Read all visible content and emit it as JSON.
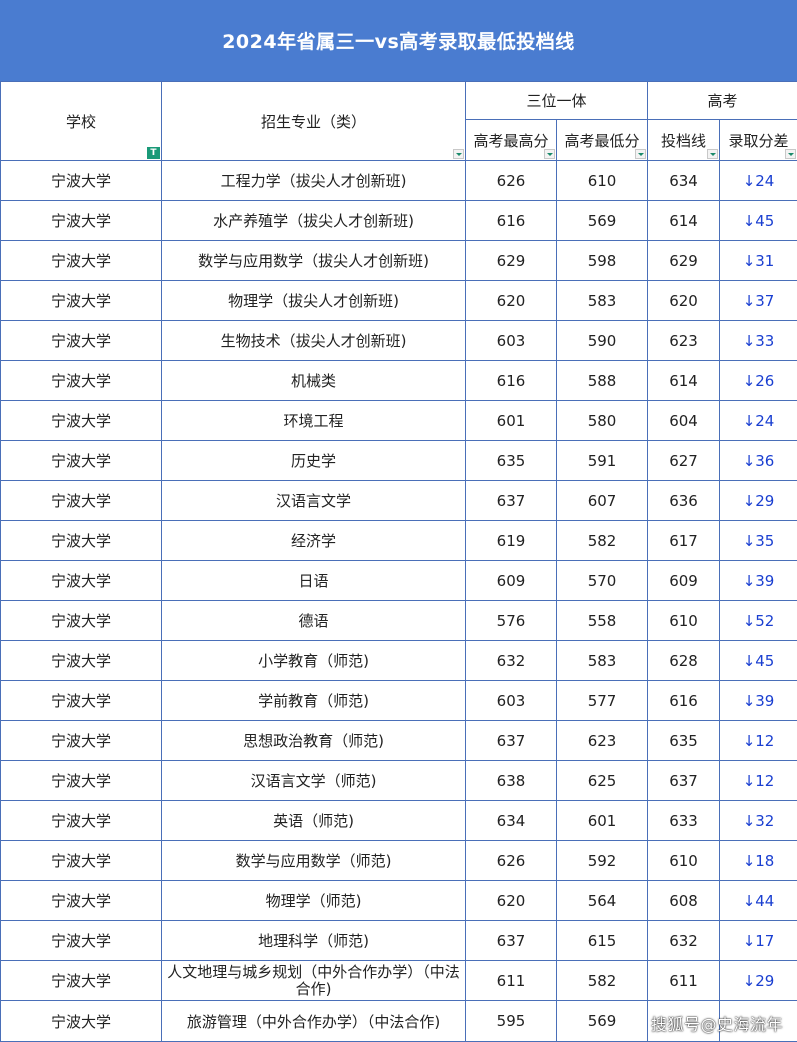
{
  "title": "2024年省属三一vs高考录取最低投档线",
  "headers": {
    "school": "学校",
    "major": "招生专业（类）",
    "group_sanwei": "三位一体",
    "group_gaokao": "高考",
    "max": "高考最高分",
    "min": "高考最低分",
    "toudang": "投档线",
    "diff": "录取分差"
  },
  "rows": [
    {
      "school": "宁波大学",
      "major": "工程力学（拔尖人才创新班)",
      "max": "626",
      "min": "610",
      "toudang": "634",
      "diff": "↓24"
    },
    {
      "school": "宁波大学",
      "major": "水产养殖学（拔尖人才创新班)",
      "max": "616",
      "min": "569",
      "toudang": "614",
      "diff": "↓45"
    },
    {
      "school": "宁波大学",
      "major": "数学与应用数学（拔尖人才创新班)",
      "max": "629",
      "min": "598",
      "toudang": "629",
      "diff": "↓31"
    },
    {
      "school": "宁波大学",
      "major": "物理学（拔尖人才创新班)",
      "max": "620",
      "min": "583",
      "toudang": "620",
      "diff": "↓37"
    },
    {
      "school": "宁波大学",
      "major": "生物技术（拔尖人才创新班)",
      "max": "603",
      "min": "590",
      "toudang": "623",
      "diff": "↓33"
    },
    {
      "school": "宁波大学",
      "major": "机械类",
      "max": "616",
      "min": "588",
      "toudang": "614",
      "diff": "↓26"
    },
    {
      "school": "宁波大学",
      "major": "环境工程",
      "max": "601",
      "min": "580",
      "toudang": "604",
      "diff": "↓24"
    },
    {
      "school": "宁波大学",
      "major": "历史学",
      "max": "635",
      "min": "591",
      "toudang": "627",
      "diff": "↓36"
    },
    {
      "school": "宁波大学",
      "major": "汉语言文学",
      "max": "637",
      "min": "607",
      "toudang": "636",
      "diff": "↓29"
    },
    {
      "school": "宁波大学",
      "major": "经济学",
      "max": "619",
      "min": "582",
      "toudang": "617",
      "diff": "↓35"
    },
    {
      "school": "宁波大学",
      "major": "日语",
      "max": "609",
      "min": "570",
      "toudang": "609",
      "diff": "↓39"
    },
    {
      "school": "宁波大学",
      "major": "德语",
      "max": "576",
      "min": "558",
      "toudang": "610",
      "diff": "↓52"
    },
    {
      "school": "宁波大学",
      "major": "小学教育（师范)",
      "max": "632",
      "min": "583",
      "toudang": "628",
      "diff": "↓45"
    },
    {
      "school": "宁波大学",
      "major": "学前教育（师范)",
      "max": "603",
      "min": "577",
      "toudang": "616",
      "diff": "↓39"
    },
    {
      "school": "宁波大学",
      "major": "思想政治教育（师范)",
      "max": "637",
      "min": "623",
      "toudang": "635",
      "diff": "↓12"
    },
    {
      "school": "宁波大学",
      "major": "汉语言文学（师范)",
      "max": "638",
      "min": "625",
      "toudang": "637",
      "diff": "↓12"
    },
    {
      "school": "宁波大学",
      "major": "英语（师范)",
      "max": "634",
      "min": "601",
      "toudang": "633",
      "diff": "↓32"
    },
    {
      "school": "宁波大学",
      "major": "数学与应用数学（师范)",
      "max": "626",
      "min": "592",
      "toudang": "610",
      "diff": "↓18"
    },
    {
      "school": "宁波大学",
      "major": "物理学（师范)",
      "max": "620",
      "min": "564",
      "toudang": "608",
      "diff": "↓44"
    },
    {
      "school": "宁波大学",
      "major": "地理科学（师范)",
      "max": "637",
      "min": "615",
      "toudang": "632",
      "diff": "↓17"
    },
    {
      "school": "宁波大学",
      "major": "人文地理与城乡规划（中外合作办学）（中法合作)",
      "max": "611",
      "min": "582",
      "toudang": "611",
      "diff": "↓29"
    },
    {
      "school": "宁波大学",
      "major": "旅游管理（中外合作办学）（中法合作)",
      "max": "595",
      "min": "569",
      "toudang": "",
      "diff": ""
    }
  ],
  "watermark": "搜狐号@史海流年",
  "colors": {
    "title_bg": "#4a7cd0",
    "border": "#4a6fb8",
    "diff_text": "#1a3fd1"
  }
}
